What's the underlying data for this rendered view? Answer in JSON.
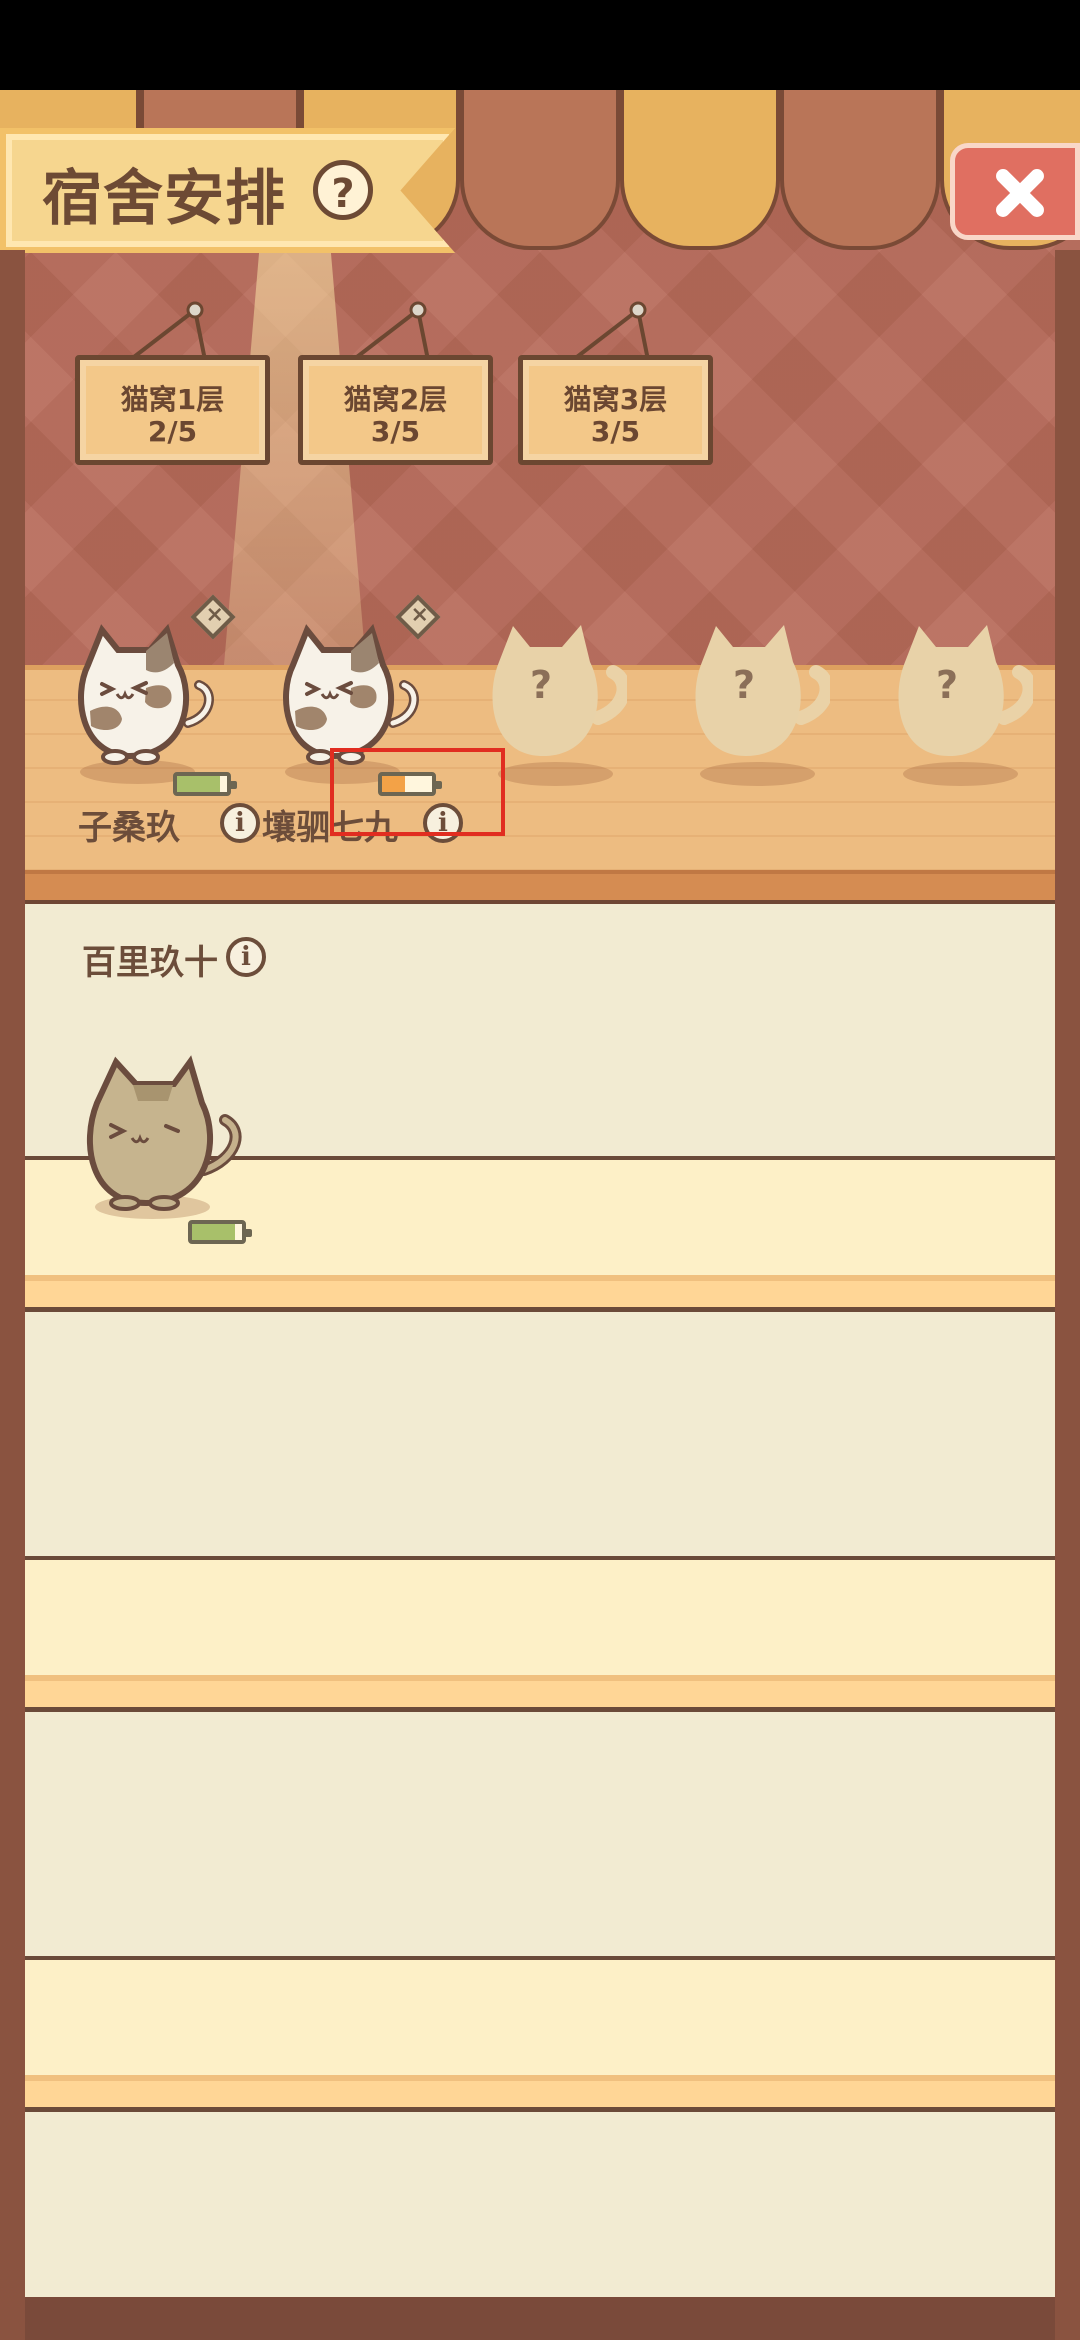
{
  "header": {
    "title": "宿舍安排",
    "help_icon": "question-mark-icon",
    "close_icon": "close-x-icon"
  },
  "rooms": [
    {
      "label_line1": "猫窝1层",
      "label_line2": "2/5"
    },
    {
      "label_line1": "猫窝2层",
      "label_line2": "3/5"
    },
    {
      "label_line1": "猫窝3层",
      "label_line2": "3/5"
    }
  ],
  "current_room": {
    "cats": [
      {
        "name": "子桑玖",
        "battery_level": 0.85,
        "battery_color": "#a8c06a"
      },
      {
        "name": "壤驷七九",
        "battery_level": 0.45,
        "battery_color": "#f3a247"
      }
    ],
    "empty_slots": [
      {
        "label": "?"
      },
      {
        "label": "?"
      },
      {
        "label": "?"
      }
    ]
  },
  "available_cats": [
    {
      "name": "百里玖十",
      "battery_level": 0.85,
      "battery_color": "#a8c06a"
    }
  ],
  "colors": {
    "wall": "#b86b5a",
    "floor": "#edbc81",
    "panel": "#f2ebd2",
    "highlight": "#e12d20"
  }
}
